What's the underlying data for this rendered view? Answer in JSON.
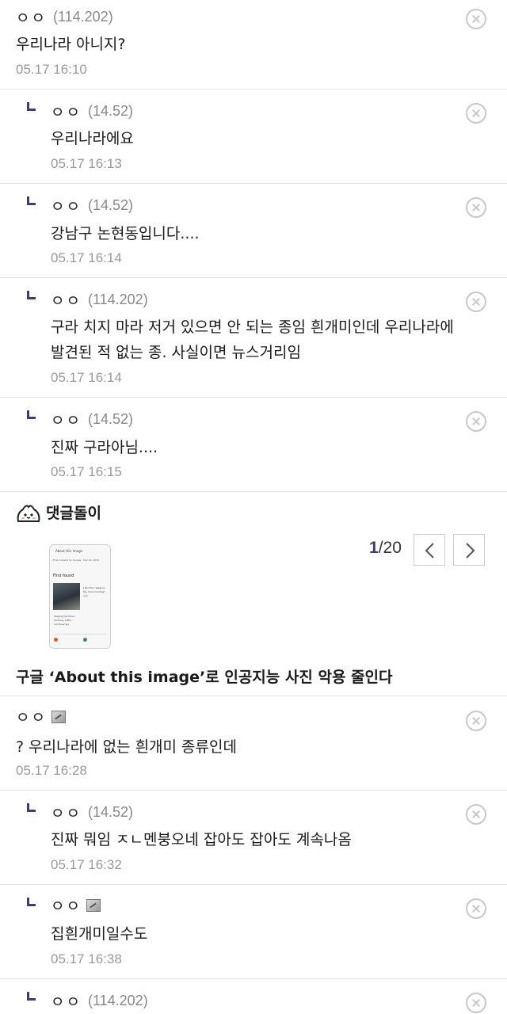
{
  "comments": [
    {
      "nick": "ㅇㅇ",
      "ip": "(114.202)",
      "body": "우리나라 아니지?",
      "date": "05.17 16:10"
    },
    {
      "nick": "ㅇㅇ",
      "ip": "(14.52)",
      "body": "우리나라에요",
      "date": "05.17 16:13"
    },
    {
      "nick": "ㅇㅇ",
      "ip": "(14.52)",
      "body": "강남구 논현동입니다....",
      "date": "05.17 16:14"
    },
    {
      "nick": "ㅇㅇ",
      "ip": "(114.202)",
      "body_line1": "구라 치지 마라 저거 있으면 안 되는 종임 흰개미인데 우리나라에",
      "body_line2": "발견된 적 없는 종. 사실이면 뉴스거리임",
      "date": "05.17 16:14"
    },
    {
      "nick": "ㅇㅇ",
      "ip": "(14.52)",
      "body": "진짜 구라아님....",
      "date": "05.17 16:15"
    }
  ],
  "bot": {
    "title": "댓글돌이",
    "page_current": "1",
    "page_total": "/20",
    "headline": "구글 ‘About this image’로 인공지능 사진 악용 줄인다",
    "thumb": {
      "title": "About this image",
      "meta": "First indexed by Google · Mar 20, 2022",
      "section": "First found",
      "caption": "I like this \"staging the moon landing\" one",
      "left_caption": "Staging the Moon Landing, 1969 - r/midjourney"
    }
  },
  "comments2": [
    {
      "nick": "ㅇㅇ",
      "body": "? 우리나라에 없는 흰개미 종류인데",
      "date": "05.17 16:28"
    },
    {
      "nick": "ㅇㅇ",
      "ip": "(14.52)",
      "body": "진짜 뭐임 ㅈㄴ멘붕오네 잡아도 잡아도 계속나옴",
      "date": "05.17 16:32"
    },
    {
      "nick": "ㅇㅇ",
      "body": "집흰개미일수도",
      "date": "05.17 16:38"
    },
    {
      "nick": "ㅇㅇ",
      "ip": "(114.202)"
    }
  ],
  "icons": {
    "delete": "close-circle-icon",
    "reply": "reply-arrow-icon",
    "member": "fixed-member-icon"
  },
  "colors": {
    "accent": "#3b3f6e",
    "divider": "#e3e3e3",
    "muted": "#999999"
  }
}
